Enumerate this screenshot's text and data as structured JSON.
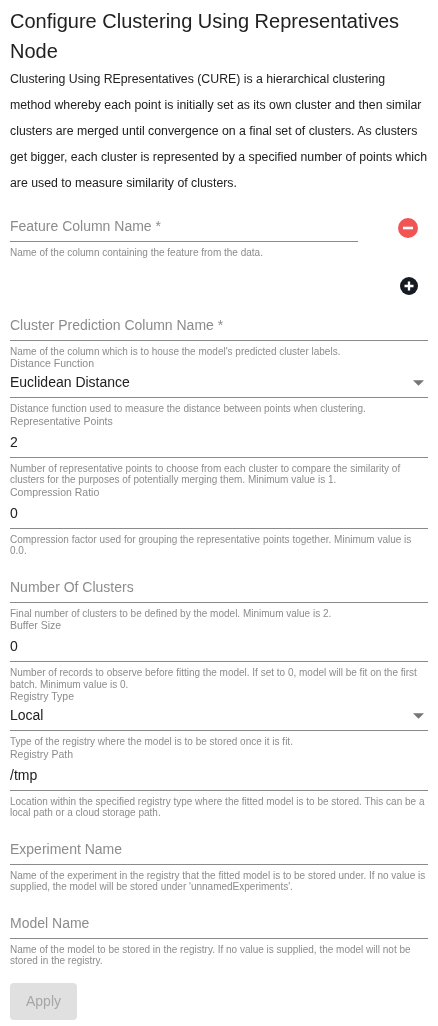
{
  "title": "Configure Clustering Using Representatives Node",
  "description": "Clustering Using REpresentatives (CURE) is a hierarchical clustering method whereby each point is initially set as its own cluster and then similar clusters are merged until convergence on a final set of clusters. As clusters get bigger, each cluster is represented by a specified number of points which are used to measure similarity of clusters.",
  "fields": [
    {
      "kind": "list",
      "placeholder": "Feature Column Name *",
      "helper": "Name of the column containing the feature from the data."
    },
    {
      "kind": "text",
      "placeholder": "Cluster Prediction Column Name *",
      "helper": "Name of the column which is to house the model's predicted cluster labels."
    },
    {
      "kind": "select",
      "label": "Distance Function",
      "value": "Euclidean Distance",
      "helper": "Distance function used to measure the distance between points when clustering."
    },
    {
      "kind": "labeled",
      "label": "Representative Points",
      "value": "2",
      "helper": "Number of representative points to choose from each cluster to compare the similarity of clusters for the purposes of potentially merging them. Minimum value is 1."
    },
    {
      "kind": "labeled",
      "label": "Compression Ratio",
      "value": "0",
      "helper": "Compression factor used for grouping the representative points together. Minimum value is 0.0."
    },
    {
      "kind": "text",
      "placeholder": "Number Of Clusters",
      "helper": "Final number of clusters to be defined by the model. Minimum value is 2."
    },
    {
      "kind": "labeled",
      "label": "Buffer Size",
      "value": "0",
      "helper": "Number of records to observe before fitting the model. If set to 0, model will be fit on the first batch. Minimum value is 0."
    },
    {
      "kind": "select",
      "label": "Registry Type",
      "value": "Local",
      "helper": "Type of the registry where the model is to be stored once it is fit."
    },
    {
      "kind": "labeled",
      "label": "Registry Path",
      "value": "/tmp",
      "helper": "Location within the specified registry type where the fitted model is to be stored. This can be a local path or a cloud storage path."
    },
    {
      "kind": "text",
      "placeholder": "Experiment Name",
      "helper": "Name of the experiment in the registry that the fitted model is to be stored under. If no value is supplied, the model will be stored under 'unnamedExperiments'."
    },
    {
      "kind": "text",
      "placeholder": "Model Name",
      "helper": "Name of the model to be stored in the registry. If no value is supplied, the model will not be stored in the registry."
    }
  ],
  "apply": {
    "label": "Apply",
    "disabled": true
  }
}
